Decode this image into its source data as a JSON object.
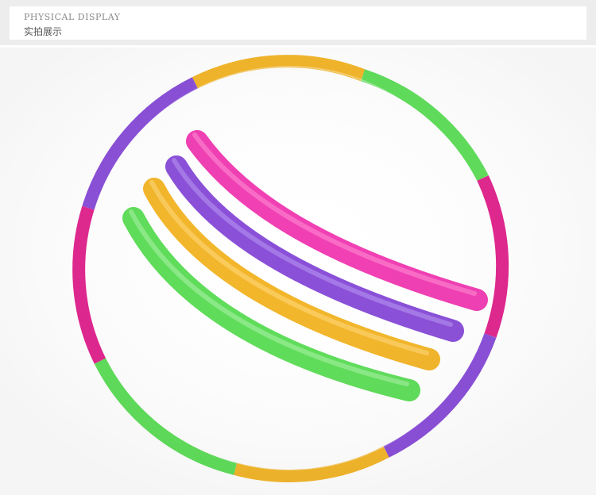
{
  "header": {
    "title_en": "PHYSICAL DISPLAY",
    "title_cn": "实拍展示"
  },
  "product_photo": {
    "subject": "segmented hula hoop",
    "colors": {
      "purple": "#8a4fd8",
      "yellow": "#f3b62a",
      "green": "#5fdd5a",
      "magenta": "#e0268f",
      "pink": "#f03fb3"
    }
  }
}
